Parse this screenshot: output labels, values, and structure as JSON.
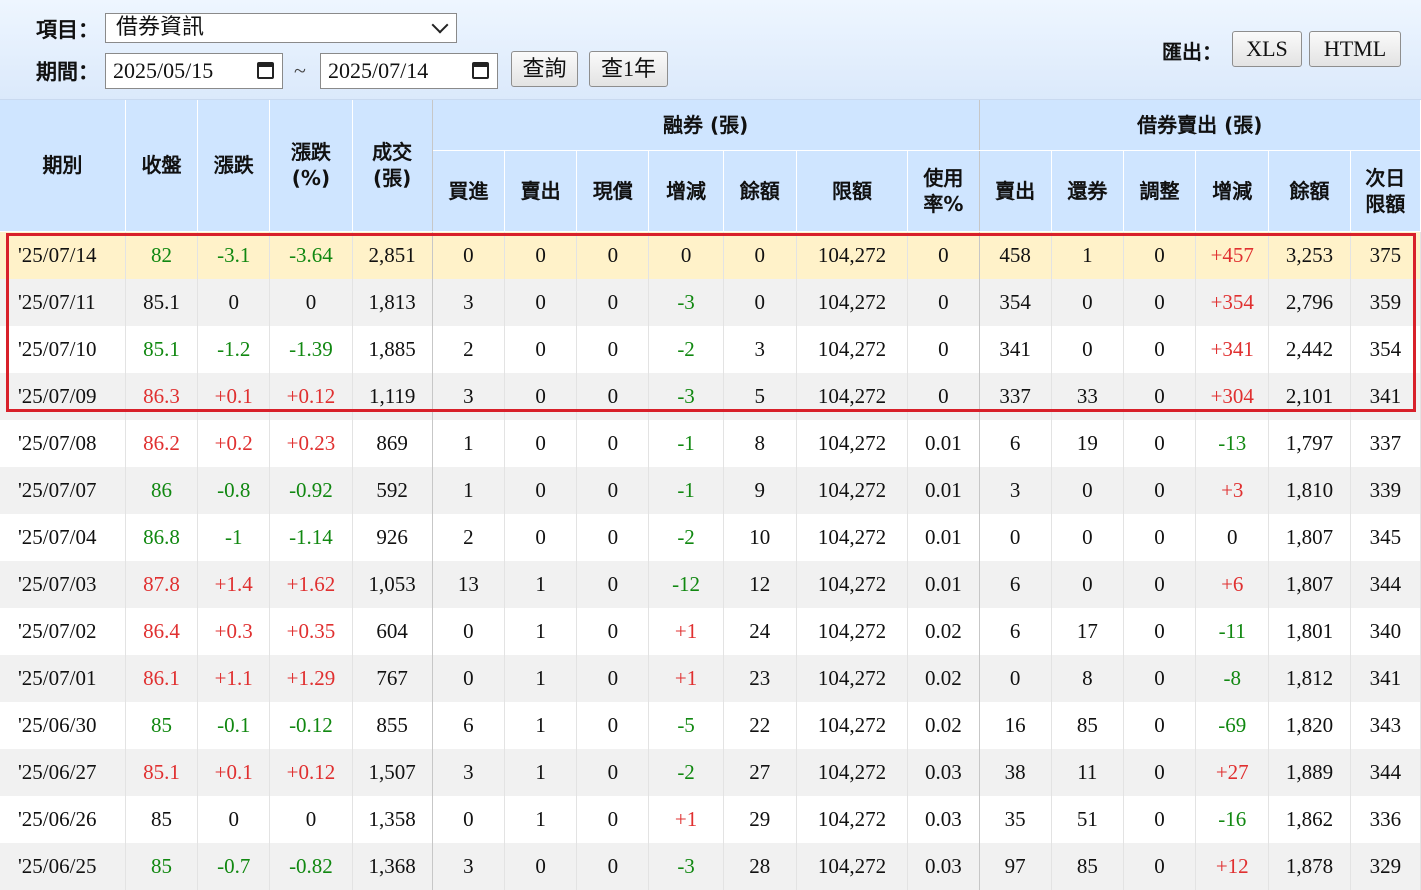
{
  "filters": {
    "item_label": "項目：",
    "item_value": "借券資訊",
    "period_label": "期間：",
    "date_from": "2025/05/15",
    "date_sep": "~",
    "date_to": "2025/07/14",
    "query_button": "查詢",
    "query_year_button": "查1年",
    "export_label": "匯出：",
    "xls_button": "XLS",
    "html_button": "HTML"
  },
  "colors": {
    "up": "#e03030",
    "down": "#118811",
    "header_bg": "#cfe5ff",
    "highlight": "#d8202a"
  },
  "table": {
    "headers": {
      "period": "期別",
      "close": "收盤",
      "change": "漲跌",
      "change_pct": "漲跌(%)",
      "volume": "成交(張)",
      "margin_group": "融券 (張)",
      "buy": "買進",
      "sell": "賣出",
      "cash_repay": "現償",
      "margin_delta": "增減",
      "margin_balance": "餘額",
      "limit": "限額",
      "usage": "使用率%",
      "lend_group": "借券賣出 (張)",
      "lend_sell": "賣出",
      "return": "還券",
      "adjust": "調整",
      "lend_delta": "增減",
      "lend_balance": "餘額",
      "next_limit": "次日限額"
    },
    "rows": [
      {
        "date": "'25/07/14",
        "close": "82",
        "chg": "-3.1",
        "pct": "-3.64",
        "vol": "2,851",
        "buy": "0",
        "sell": "0",
        "cash": "0",
        "mdelta": "0",
        "mbal": "0",
        "limit": "104,272",
        "usage": "0",
        "lsell": "458",
        "ret": "1",
        "adj": "0",
        "ldelta": "+457",
        "lbal": "3,253",
        "next": "375",
        "dir": "down",
        "mdir": "flat",
        "ldir": "up"
      },
      {
        "date": "'25/07/11",
        "close": "85.1",
        "chg": "0",
        "pct": "0",
        "vol": "1,813",
        "buy": "3",
        "sell": "0",
        "cash": "0",
        "mdelta": "-3",
        "mbal": "0",
        "limit": "104,272",
        "usage": "0",
        "lsell": "354",
        "ret": "0",
        "adj": "0",
        "ldelta": "+354",
        "lbal": "2,796",
        "next": "359",
        "dir": "flat",
        "mdir": "down",
        "ldir": "up"
      },
      {
        "date": "'25/07/10",
        "close": "85.1",
        "chg": "-1.2",
        "pct": "-1.39",
        "vol": "1,885",
        "buy": "2",
        "sell": "0",
        "cash": "0",
        "mdelta": "-2",
        "mbal": "3",
        "limit": "104,272",
        "usage": "0",
        "lsell": "341",
        "ret": "0",
        "adj": "0",
        "ldelta": "+341",
        "lbal": "2,442",
        "next": "354",
        "dir": "down",
        "mdir": "down",
        "ldir": "up"
      },
      {
        "date": "'25/07/09",
        "close": "86.3",
        "chg": "+0.1",
        "pct": "+0.12",
        "vol": "1,119",
        "buy": "3",
        "sell": "0",
        "cash": "0",
        "mdelta": "-3",
        "mbal": "5",
        "limit": "104,272",
        "usage": "0",
        "lsell": "337",
        "ret": "33",
        "adj": "0",
        "ldelta": "+304",
        "lbal": "2,101",
        "next": "341",
        "dir": "up",
        "mdir": "down",
        "ldir": "up"
      },
      {
        "date": "'25/07/08",
        "close": "86.2",
        "chg": "+0.2",
        "pct": "+0.23",
        "vol": "869",
        "buy": "1",
        "sell": "0",
        "cash": "0",
        "mdelta": "-1",
        "mbal": "8",
        "limit": "104,272",
        "usage": "0.01",
        "lsell": "6",
        "ret": "19",
        "adj": "0",
        "ldelta": "-13",
        "lbal": "1,797",
        "next": "337",
        "dir": "up",
        "mdir": "down",
        "ldir": "down"
      },
      {
        "date": "'25/07/07",
        "close": "86",
        "chg": "-0.8",
        "pct": "-0.92",
        "vol": "592",
        "buy": "1",
        "sell": "0",
        "cash": "0",
        "mdelta": "-1",
        "mbal": "9",
        "limit": "104,272",
        "usage": "0.01",
        "lsell": "3",
        "ret": "0",
        "adj": "0",
        "ldelta": "+3",
        "lbal": "1,810",
        "next": "339",
        "dir": "down",
        "mdir": "down",
        "ldir": "up"
      },
      {
        "date": "'25/07/04",
        "close": "86.8",
        "chg": "-1",
        "pct": "-1.14",
        "vol": "926",
        "buy": "2",
        "sell": "0",
        "cash": "0",
        "mdelta": "-2",
        "mbal": "10",
        "limit": "104,272",
        "usage": "0.01",
        "lsell": "0",
        "ret": "0",
        "adj": "0",
        "ldelta": "0",
        "lbal": "1,807",
        "next": "345",
        "dir": "down",
        "mdir": "down",
        "ldir": "flat"
      },
      {
        "date": "'25/07/03",
        "close": "87.8",
        "chg": "+1.4",
        "pct": "+1.62",
        "vol": "1,053",
        "buy": "13",
        "sell": "1",
        "cash": "0",
        "mdelta": "-12",
        "mbal": "12",
        "limit": "104,272",
        "usage": "0.01",
        "lsell": "6",
        "ret": "0",
        "adj": "0",
        "ldelta": "+6",
        "lbal": "1,807",
        "next": "344",
        "dir": "up",
        "mdir": "down",
        "ldir": "up"
      },
      {
        "date": "'25/07/02",
        "close": "86.4",
        "chg": "+0.3",
        "pct": "+0.35",
        "vol": "604",
        "buy": "0",
        "sell": "1",
        "cash": "0",
        "mdelta": "+1",
        "mbal": "24",
        "limit": "104,272",
        "usage": "0.02",
        "lsell": "6",
        "ret": "17",
        "adj": "0",
        "ldelta": "-11",
        "lbal": "1,801",
        "next": "340",
        "dir": "up",
        "mdir": "up",
        "ldir": "down"
      },
      {
        "date": "'25/07/01",
        "close": "86.1",
        "chg": "+1.1",
        "pct": "+1.29",
        "vol": "767",
        "buy": "0",
        "sell": "1",
        "cash": "0",
        "mdelta": "+1",
        "mbal": "23",
        "limit": "104,272",
        "usage": "0.02",
        "lsell": "0",
        "ret": "8",
        "adj": "0",
        "ldelta": "-8",
        "lbal": "1,812",
        "next": "341",
        "dir": "up",
        "mdir": "up",
        "ldir": "down"
      },
      {
        "date": "'25/06/30",
        "close": "85",
        "chg": "-0.1",
        "pct": "-0.12",
        "vol": "855",
        "buy": "6",
        "sell": "1",
        "cash": "0",
        "mdelta": "-5",
        "mbal": "22",
        "limit": "104,272",
        "usage": "0.02",
        "lsell": "16",
        "ret": "85",
        "adj": "0",
        "ldelta": "-69",
        "lbal": "1,820",
        "next": "343",
        "dir": "down",
        "mdir": "down",
        "ldir": "down"
      },
      {
        "date": "'25/06/27",
        "close": "85.1",
        "chg": "+0.1",
        "pct": "+0.12",
        "vol": "1,507",
        "buy": "3",
        "sell": "1",
        "cash": "0",
        "mdelta": "-2",
        "mbal": "27",
        "limit": "104,272",
        "usage": "0.03",
        "lsell": "38",
        "ret": "11",
        "adj": "0",
        "ldelta": "+27",
        "lbal": "1,889",
        "next": "344",
        "dir": "up",
        "mdir": "down",
        "ldir": "up"
      },
      {
        "date": "'25/06/26",
        "close": "85",
        "chg": "0",
        "pct": "0",
        "vol": "1,358",
        "buy": "0",
        "sell": "1",
        "cash": "0",
        "mdelta": "+1",
        "mbal": "29",
        "limit": "104,272",
        "usage": "0.03",
        "lsell": "35",
        "ret": "51",
        "adj": "0",
        "ldelta": "-16",
        "lbal": "1,862",
        "next": "336",
        "dir": "flat",
        "mdir": "up",
        "ldir": "down"
      },
      {
        "date": "'25/06/25",
        "close": "85",
        "chg": "-0.7",
        "pct": "-0.82",
        "vol": "1,368",
        "buy": "3",
        "sell": "0",
        "cash": "0",
        "mdelta": "-3",
        "mbal": "28",
        "limit": "104,272",
        "usage": "0.03",
        "lsell": "97",
        "ret": "85",
        "adj": "0",
        "ldelta": "+12",
        "lbal": "1,878",
        "next": "329",
        "dir": "down",
        "mdir": "down",
        "ldir": "up"
      }
    ]
  }
}
